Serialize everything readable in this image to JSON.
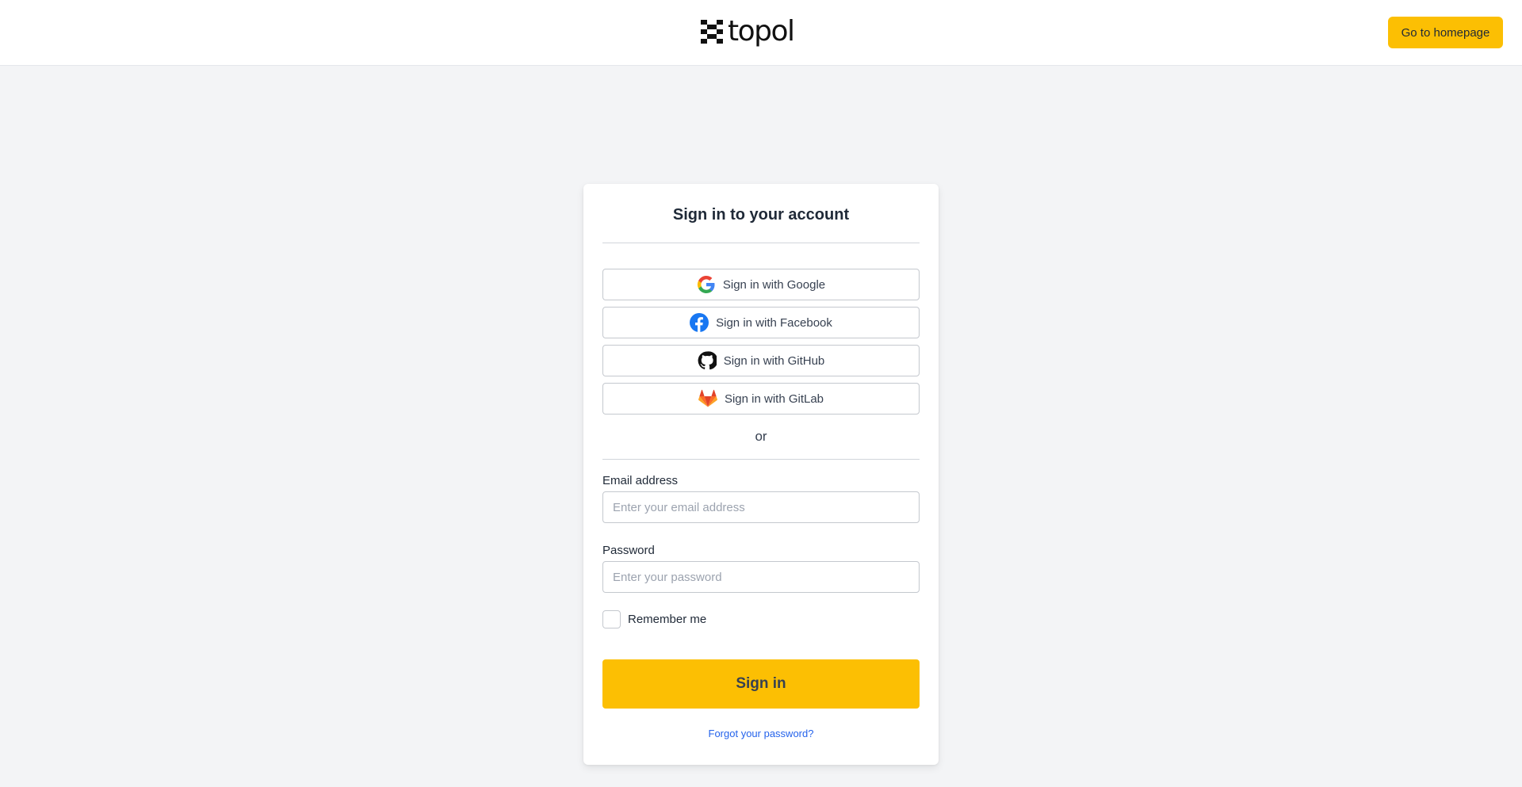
{
  "header": {
    "logo_text": "topol",
    "homepage_button": "Go to homepage"
  },
  "card": {
    "title": "Sign in to your account",
    "social": [
      {
        "label": "Sign in with Google",
        "icon": "google-icon"
      },
      {
        "label": "Sign in with Facebook",
        "icon": "facebook-icon"
      },
      {
        "label": "Sign in with GitHub",
        "icon": "github-icon"
      },
      {
        "label": "Sign in with GitLab",
        "icon": "gitlab-icon"
      }
    ],
    "or_text": "or",
    "email": {
      "label": "Email address",
      "placeholder": "Enter your email address",
      "value": ""
    },
    "password": {
      "label": "Password",
      "placeholder": "Enter your password",
      "value": ""
    },
    "remember_label": "Remember me",
    "remember_checked": false,
    "signin_button": "Sign in",
    "forgot_link": "Forgot your password?"
  },
  "colors": {
    "accent": "#fcbf03",
    "link": "#2563eb",
    "background": "#f3f4f6"
  }
}
